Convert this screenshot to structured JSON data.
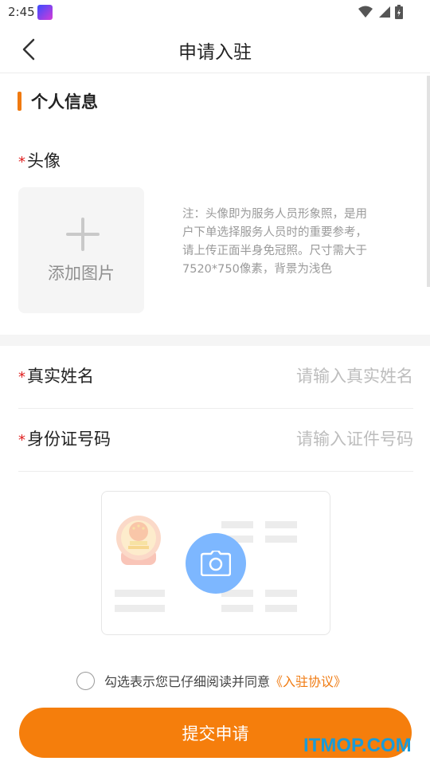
{
  "status_bar": {
    "time": "2:45",
    "icons": [
      "app-notification-icon",
      "wifi-icon",
      "signal-icon",
      "battery-icon"
    ]
  },
  "nav": {
    "title": "申请入驻",
    "back_icon": "chevron-left-icon"
  },
  "personal_info": {
    "section_title": "个人信息",
    "avatar": {
      "required_mark": "*",
      "label": "头像",
      "upload_label": "添加图片",
      "note": "注：头像即为服务人员形象照，是用户下单选择服务人员时的重要参考，请上传正面半身免冠照。尺寸需大于7520*750像素，背景为浅色"
    }
  },
  "form": {
    "real_name": {
      "required_mark": "*",
      "label": "真实姓名",
      "placeholder": "请输入真实姓名",
      "value": ""
    },
    "id_number": {
      "required_mark": "*",
      "label": "身份证号码",
      "placeholder": "请输入证件号码",
      "value": ""
    },
    "id_card_upload": {
      "icons": [
        "national-emblem-icon",
        "camera-icon"
      ]
    }
  },
  "agreement": {
    "checked": false,
    "text": "勾选表示您已仔细阅读并同意",
    "link": "《入驻协议》"
  },
  "submit": {
    "label": "提交申请"
  },
  "watermark": "ITMOP.COM",
  "colors": {
    "accent": "#f57e0c",
    "required": "#e02020",
    "camera": "#7db7ff",
    "watermark": "#1a9bd8"
  }
}
